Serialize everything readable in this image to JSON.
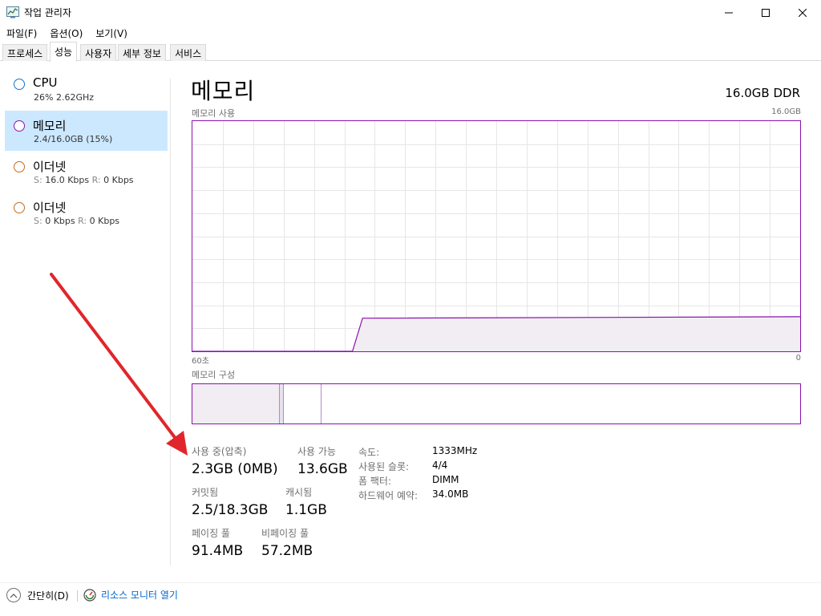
{
  "window": {
    "title": "작업 관리자",
    "icon": "task-manager-icon"
  },
  "menu": [
    "파일(F)",
    "옵션(O)",
    "보기(V)"
  ],
  "tabs": [
    "프로세스",
    "성능",
    "사용자",
    "세부 정보",
    "서비스"
  ],
  "active_tab": "성능",
  "sidebar": {
    "items": [
      {
        "title": "CPU",
        "sub": "26%  2.62GHz",
        "circle_color": "#1a73c4"
      },
      {
        "title": "메모리",
        "sub": "2.4/16.0GB (15%)",
        "circle_color": "#8b12ae",
        "selected": true
      },
      {
        "title": "이더넷",
        "s_label": "S:",
        "s_value": "16.0 Kbps",
        "r_label": "R:",
        "r_value": "0 Kbps",
        "circle_color": "#c86b1a"
      },
      {
        "title": "이더넷",
        "s_label": "S:",
        "s_value": "0 Kbps",
        "r_label": "R:",
        "r_value": "0 Kbps",
        "circle_color": "#c86b1a"
      }
    ]
  },
  "main": {
    "title": "메모리",
    "spec": "16.0GB DDR",
    "usage_label": "메모리 사용",
    "usage_max": "16.0GB",
    "time_left": "60초",
    "time_right": "0",
    "composition_label": "메모리 구성"
  },
  "stats": {
    "in_use_label": "사용 중(압축)",
    "in_use_value": "2.3GB (0MB)",
    "available_label": "사용 가능",
    "available_value": "13.6GB",
    "committed_label": "커밋됨",
    "committed_value": "2.5/18.3GB",
    "cached_label": "캐시됨",
    "cached_value": "1.1GB",
    "paged_label": "페이징 풀",
    "paged_value": "91.4MB",
    "nonpaged_label": "비페이징 풀",
    "nonpaged_value": "57.2MB"
  },
  "specs": [
    {
      "label": "속도:",
      "value": "1333MHz"
    },
    {
      "label": "사용된 슬롯:",
      "value": "4/4"
    },
    {
      "label": "폼 팩터:",
      "value": "DIMM"
    },
    {
      "label": "하드웨어 예약:",
      "value": "34.0MB"
    }
  ],
  "footer": {
    "fewer_details": "간단히(D)",
    "resource_monitor": "리소스 모니터 열기"
  },
  "colors": {
    "memory_accent": "#8b12ae",
    "graph_fill": "#f1edf3",
    "grid": "#e6e6e6",
    "selected_bg": "#cce8ff",
    "link": "#0066cc",
    "annotation_arrow": "#e0262b"
  },
  "chart_data": {
    "type": "area",
    "ylabel": "메모리 사용",
    "ylim": [
      0,
      16.0
    ],
    "xlim": [
      60,
      0
    ],
    "series": [
      {
        "x": [
          60,
          44.2,
          43.2,
          0
        ],
        "y": [
          0,
          0,
          2.3,
          2.4
        ]
      }
    ]
  }
}
